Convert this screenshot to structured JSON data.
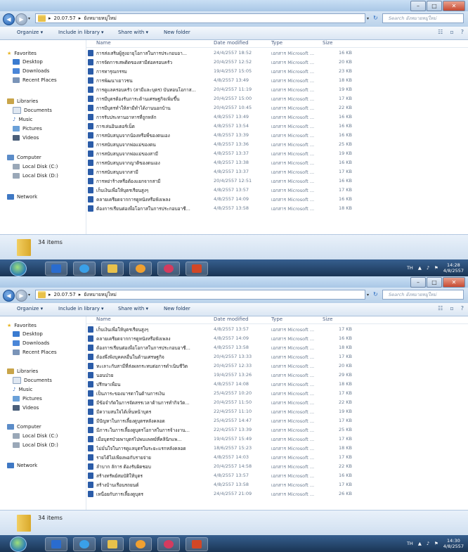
{
  "window1": {
    "breadcrumb": [
      "20.07.57",
      "ยังหมายหมู่ใหม่"
    ],
    "search_placeholder": "Search ยังหมายหมู่ใหม่",
    "toolbar": {
      "organize": "Organize ▾",
      "include": "Include in library ▾",
      "share": "Share with ▾",
      "newfolder": "New folder"
    },
    "headers": {
      "name": "Name",
      "date": "Date modified",
      "type": "Type",
      "size": "Size"
    },
    "files": [
      {
        "name": "การส่งเสริมผู้สูงอายุโอกาสในการประกอบอา...",
        "date": "24/4/2557 18:52",
        "type": "เอกสาร Microsoft ...",
        "size": "16 KB"
      },
      {
        "name": "การจัดการเสพติดของสามีต่อครอบครัว",
        "date": "20/4/2557 12:52",
        "type": "เอกสาร Microsoft ...",
        "size": "20 KB"
      },
      {
        "name": "การทารุณกรรม",
        "date": "19/4/2557 15:05",
        "type": "เอกสาร Microsoft ...",
        "size": "23 KB"
      },
      {
        "name": "การพัฒนาเยาวชน",
        "date": "4/8/2557 13:49",
        "type": "เอกสาร Microsoft ...",
        "size": "18 KB"
      },
      {
        "name": "การดูแลครอบครัว (สามีและบุตร) บันทอนโอกาส...",
        "date": "20/4/2557 11:19",
        "type": "เอกสาร Microsoft ...",
        "size": "19 KB"
      },
      {
        "name": "การมีบุตรต้องรับภาระด้านเศรษฐกิจเพิ่มขึ้น",
        "date": "20/4/2557 15:00",
        "type": "เอกสาร Microsoft ...",
        "size": "17 KB"
      },
      {
        "name": "การมีบุตรทำให้สามีทำได้งานนอกบ้าน",
        "date": "20/4/2557 10:45",
        "type": "เอกสาร Microsoft ...",
        "size": "22 KB"
      },
      {
        "name": "การรับประทานอาหารที่ถูกหลัก",
        "date": "4/8/2557 13:49",
        "type": "เอกสาร Microsoft ...",
        "size": "16 KB"
      },
      {
        "name": "การเล่นอินเตอร์เน็ต",
        "date": "4/8/2557 13:54",
        "type": "เอกสาร Microsoft ...",
        "size": "16 KB"
      },
      {
        "name": "การสนับสนุนจากน้องหรือพี่ของตนเอง",
        "date": "4/8/2557 13:39",
        "type": "เอกสาร Microsoft ...",
        "size": "16 KB"
      },
      {
        "name": "การสนับสนุนจากพ่อแม่ของตน",
        "date": "4/8/2557 13:36",
        "type": "เอกสาร Microsoft ...",
        "size": "25 KB"
      },
      {
        "name": "การสนับสนุนจากพ่อแม่ของสามี",
        "date": "4/8/2557 13:37",
        "type": "เอกสาร Microsoft ...",
        "size": "19 KB"
      },
      {
        "name": "การสนับสนุนจากญาติของตนเอง",
        "date": "4/8/2557 13:38",
        "type": "เอกสาร Microsoft ...",
        "size": "16 KB"
      },
      {
        "name": "การสนับสนุนจากสามี",
        "date": "4/8/2557 13:37",
        "type": "เอกสาร Microsoft ...",
        "size": "17 KB"
      },
      {
        "name": "การหย่าร้างหรือต้องแยกจากสามี",
        "date": "20/4/2557 12:51",
        "type": "เอกสาร Microsoft ...",
        "size": "16 KB"
      },
      {
        "name": "เก็บเงินเพื่อให้บุตรเรียนสูงๆ",
        "date": "4/8/2557 13:57",
        "type": "เอกสาร Microsoft ...",
        "size": "17 KB"
      },
      {
        "name": "คลายเครียดจากการดูหนังหรือฟังเพลง",
        "date": "4/8/2557 14:09",
        "type": "เอกสาร Microsoft ...",
        "size": "16 KB"
      },
      {
        "name": "ต้องการเรียนต่อเพื่อโอกาสในการประกอบอาชี...",
        "date": "4/8/2557 13:58",
        "type": "เอกสาร Microsoft ...",
        "size": "18 KB"
      }
    ],
    "item_count": "34 items",
    "lang": "TH",
    "clock_time": "14:28",
    "clock_date": "4/8/2557"
  },
  "window2": {
    "breadcrumb": [
      "20.07.57",
      "ยังหมายหมู่ใหม่"
    ],
    "search_placeholder": "Search ยังหมายหมู่ใหม่",
    "toolbar": {
      "organize": "Organize ▾",
      "include": "Include in library ▾",
      "share": "Share with ▾",
      "newfolder": "New folder"
    },
    "headers": {
      "name": "Name",
      "date": "Date modified",
      "type": "Type",
      "size": "Size"
    },
    "files": [
      {
        "name": "เก็บเงินเพื่อให้บุตรเรียนสูงๆ",
        "date": "4/8/2557 13:57",
        "type": "เอกสาร Microsoft ...",
        "size": "17 KB"
      },
      {
        "name": "คลายเครียดจากการดูหนังหรือฟังเพลง",
        "date": "4/8/2557 14:09",
        "type": "เอกสาร Microsoft ...",
        "size": "16 KB"
      },
      {
        "name": "ต้องการเรียนต่อเพื่อโอกาสในการประกอบอาชี...",
        "date": "4/8/2557 13:58",
        "type": "เอกสาร Microsoft ...",
        "size": "18 KB"
      },
      {
        "name": "ต้องพึ่งพิงบุคคลอื่นในด้านเศรษฐกิจ",
        "date": "20/4/2557 13:33",
        "type": "เอกสาร Microsoft ...",
        "size": "17 KB"
      },
      {
        "name": "ทะเลาะกับสามีที่ส่งผลกระทบต่อการดำเนินชีวิต",
        "date": "20/4/2557 12:33",
        "type": "เอกสาร Microsoft ...",
        "size": "20 KB"
      },
      {
        "name": "นอนป่วย",
        "date": "19/4/2557 13:26",
        "type": "เอกสาร Microsoft ...",
        "size": "29 KB"
      },
      {
        "name": "ปรึกษาเพื่อน",
        "date": "4/8/2557 14:08",
        "type": "เอกสาร Microsoft ...",
        "size": "18 KB"
      },
      {
        "name": "เป็นภาระของมารดาในด้านการเงิน",
        "date": "25/4/2557 10:20",
        "type": "เอกสาร Microsoft ...",
        "size": "17 KB"
      },
      {
        "name": "มีข้อจำกัดในการจัดสรรเวลาด้านการทำกิจวัต...",
        "date": "20/4/2557 11:50",
        "type": "เอกสาร Microsoft ...",
        "size": "22 KB"
      },
      {
        "name": "มีความสนใจได้เห็นหน้าบุตร",
        "date": "22/4/2557 11:10",
        "type": "เอกสาร Microsoft ...",
        "size": "19 KB"
      },
      {
        "name": "มีปัญหาในการเลี้ยงดูบุตรหลังคลอด",
        "date": "25/4/2557 14:47",
        "type": "เอกสาร Microsoft ...",
        "size": "17 KB"
      },
      {
        "name": "มีภาระในการเลี้ยงดูบุตรโอกาสในการจ้างงาน...",
        "date": "22/4/2557 13:39",
        "type": "เอกสาร Microsoft ...",
        "size": "25 KB"
      },
      {
        "name": "เมื่อบุตรป่วยพาบุตรไปพบแพทย์ที่คลินิกแพ...",
        "date": "19/4/2557 15:49",
        "type": "เอกสาร Microsoft ...",
        "size": "17 KB"
      },
      {
        "name": "ไม่มั่นใจในการดูแลบุตรในระยะแรกหลังคลอด",
        "date": "18/6/2557 15:23",
        "type": "เอกสาร Microsoft ...",
        "size": "18 KB"
      },
      {
        "name": "รายได้ไม่เพียงพอกับรายจ่าย",
        "date": "4/8/2557 14:03",
        "type": "เอกสาร Microsoft ...",
        "size": "17 KB"
      },
      {
        "name": "ลำบาก ลัการ ต้องรับผิดชอบ",
        "date": "20/4/2557 14:58",
        "type": "เอกสาร Microsoft ...",
        "size": "22 KB"
      },
      {
        "name": "สร้างทรัพย์สมบัติให้บุตร",
        "date": "4/8/2557 13:57",
        "type": "เอกสาร Microsoft ...",
        "size": "16 KB"
      },
      {
        "name": "สร้างบ้านเรือนรถยนต์",
        "date": "4/8/2557 13:58",
        "type": "เอกสาร Microsoft ...",
        "size": "17 KB"
      },
      {
        "name": "เหนื่อยกับการเลี้ยงดูบุตร",
        "date": "24/4/2557 21:09",
        "type": "เอกสาร Microsoft ...",
        "size": "26 KB"
      }
    ],
    "item_count": "34 items",
    "lang": "TH",
    "clock_time": "14:30",
    "clock_date": "4/8/2557"
  },
  "nav": {
    "favorites": "Favorites",
    "desktop": "Desktop",
    "downloads": "Downloads",
    "recent": "Recent Places",
    "libraries": "Libraries",
    "documents": "Documents",
    "music": "Music",
    "pictures": "Pictures",
    "videos": "Videos",
    "computer": "Computer",
    "local_c": "Local Disk (C:)",
    "local_d": "Local Disk (D:)",
    "network": "Network"
  },
  "colors": {
    "accent": "#2b5ca8",
    "taskbar": "#1f3d63",
    "details_bar": "#dbe7f4"
  }
}
